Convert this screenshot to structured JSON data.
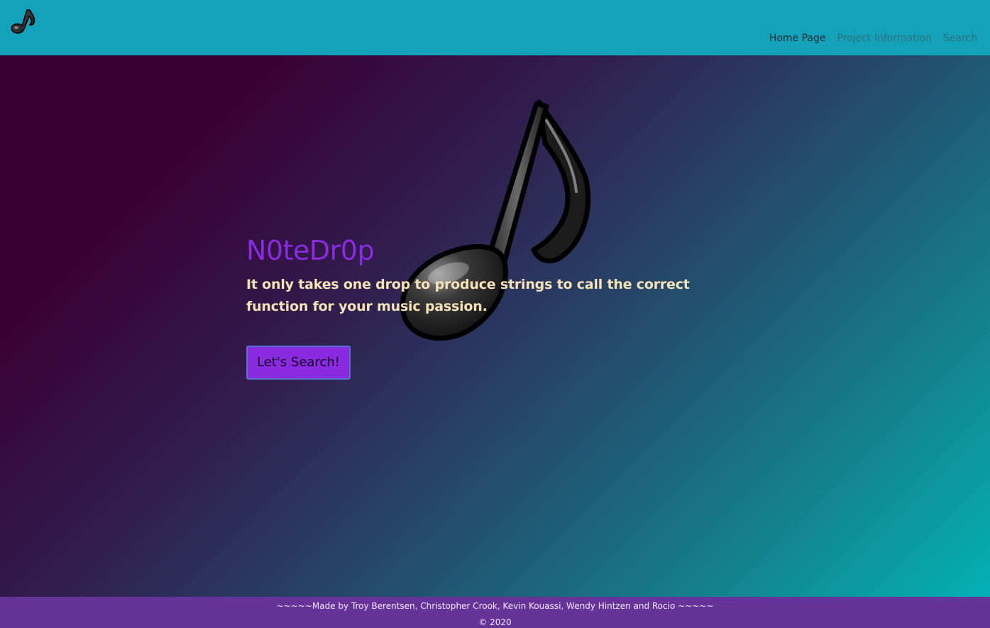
{
  "navbar": {
    "logo_icon": "music-note-icon",
    "links": [
      {
        "label": "Home Page",
        "active": true
      },
      {
        "label": "Project Information",
        "active": false
      },
      {
        "label": "Search",
        "active": false
      }
    ]
  },
  "hero": {
    "background_icon": "music-note-icon",
    "title": "N0teDr0p",
    "subtitle": "It only takes one drop to produce strings to call the correct function for your music passion.",
    "button_label": "Let's Search!"
  },
  "footer": {
    "credits": "~~~~~Made by Troy Berentsen, Christopher Crook, Kevin Kouassi, Wendy Hintzen and Rocio ~~~~~",
    "copyright": "© 2020"
  },
  "colors": {
    "navbar": "#14a2ba",
    "accent": "#8a2be2",
    "subtitle": "#f6e3b7",
    "footer": "#663399"
  }
}
